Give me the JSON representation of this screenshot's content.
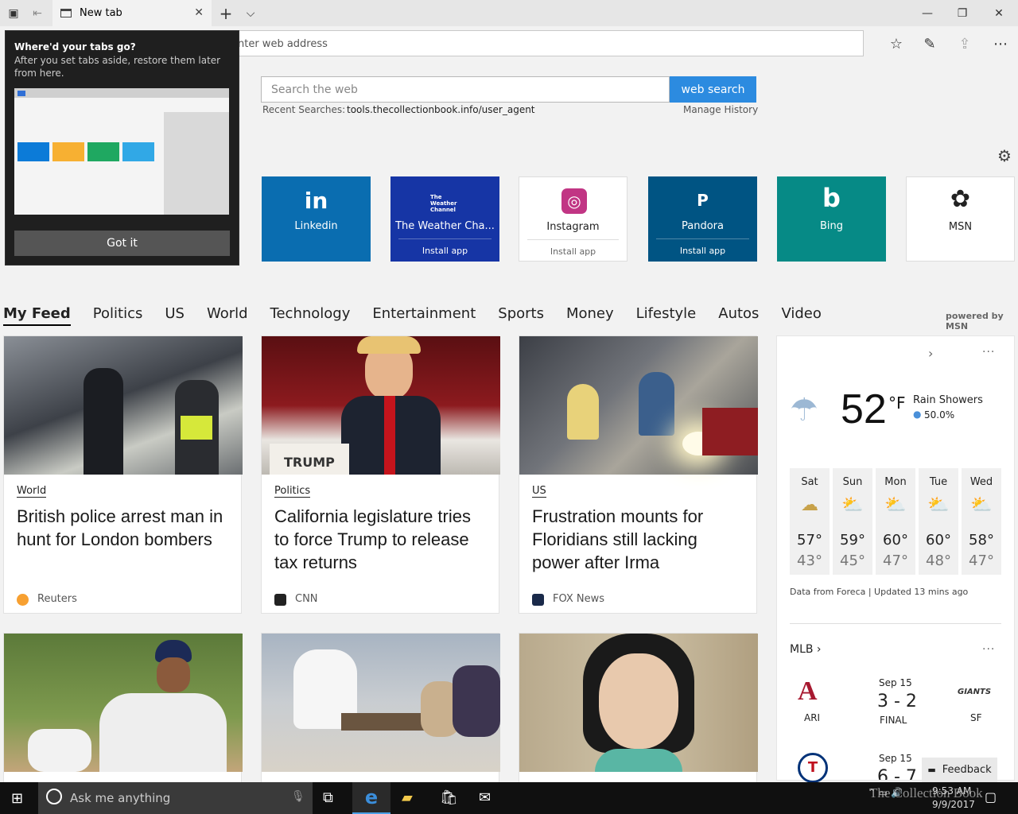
{
  "tabbar": {
    "tab_title": "New tab",
    "close_glyph": "✕",
    "new_tab_glyph": "+",
    "tab_list_glyph": "⌵",
    "minimize_glyph": "—",
    "restore_glyph": "❐",
    "window_close_glyph": "✕"
  },
  "address": {
    "placeholder": "nter web address"
  },
  "search": {
    "placeholder": "Search the web",
    "button_label": "web search",
    "recent_label": "Recent Searches:",
    "recent_value": "tools.thecollectionbook.info/user_agent",
    "manage_history": "Manage History"
  },
  "tiles": [
    {
      "label": "Linkedin",
      "icon_text": "in",
      "install": "",
      "color": "#0a6db0"
    },
    {
      "label": "The Weather Cha...",
      "icon_text": "The Weather Channel",
      "install": "Install app",
      "color": "#1635a5"
    },
    {
      "label": "Instagram",
      "icon_text": "◎",
      "install": "Install app",
      "color": "#ffffff"
    },
    {
      "label": "Pandora",
      "icon_text": "P",
      "install": "Install app",
      "color": "#005483"
    },
    {
      "label": "Bing",
      "icon_text": "b",
      "install": "",
      "color": "#068a86"
    },
    {
      "label": "MSN",
      "icon_text": "✿",
      "install": "",
      "color": "#ffffff"
    }
  ],
  "feed_nav": [
    "My Feed",
    "Politics",
    "US",
    "World",
    "Technology",
    "Entertainment",
    "Sports",
    "Money",
    "Lifestyle",
    "Autos",
    "Video"
  ],
  "powered_by": "powered by MSN",
  "cards": [
    {
      "category": "World",
      "headline": "British police arrest man in hunt for London bombers",
      "source": "Reuters"
    },
    {
      "category": "Politics",
      "headline": "California legislature tries to force Trump to release tax returns",
      "source": "CNN"
    },
    {
      "category": "US",
      "headline": "Frustration mounts for Floridians still lacking power after Irma",
      "source": "FOX News"
    }
  ],
  "weather": {
    "temperature": "52",
    "unit": "°F",
    "condition": "Rain Showers",
    "precip": "50.0%",
    "next_glyph": "›",
    "more_glyph": "···",
    "days": [
      {
        "name": "Sat",
        "high": "57°",
        "low": "43°"
      },
      {
        "name": "Sun",
        "high": "59°",
        "low": "45°"
      },
      {
        "name": "Mon",
        "high": "60°",
        "low": "47°"
      },
      {
        "name": "Tue",
        "high": "60°",
        "low": "48°"
      },
      {
        "name": "Wed",
        "high": "58°",
        "low": "47°"
      }
    ],
    "footer": "Data from Foreca | Updated 13 mins ago"
  },
  "mlb": {
    "title": "MLB",
    "game1": {
      "date": "Sep 15",
      "score": "3 - 2",
      "status": "FINAL",
      "team1": "ARI",
      "team2": "SF",
      "team2_logo": "GIANTS"
    },
    "game2": {
      "date": "Sep 15",
      "score": "6 - 7"
    }
  },
  "popup": {
    "title": "Where'd your tabs go?",
    "body": "After you set tabs aside, restore them later from here.",
    "button": "Got it"
  },
  "feedback": "Feedback",
  "taskbar": {
    "search_placeholder": "Ask me anything",
    "time": "9:53 AM",
    "date": "9/9/2017"
  },
  "watermark": "The Collection Book"
}
